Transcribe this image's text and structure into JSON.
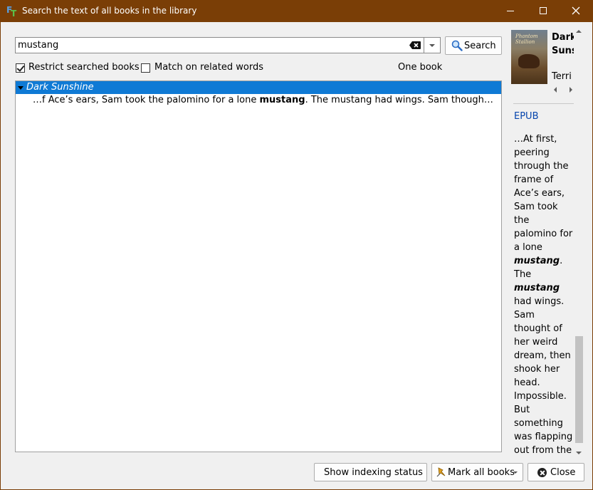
{
  "window": {
    "title": "Search the text of all books in the library"
  },
  "search": {
    "query": "mustang",
    "button_label": "Search"
  },
  "options": {
    "restrict_label": "Restrict searched books",
    "restrict_checked": true,
    "related_label": "Match on related words",
    "related_checked": false,
    "count_text": "One book"
  },
  "results": [
    {
      "book_title": "Dark Sunshine",
      "snippet_before": "…f Ace’s ears, Sam took the palomino for a lone ",
      "snippet_match": "mustang",
      "snippet_after": ". The mustang had wings. Sam thought of her w…"
    }
  ],
  "details": {
    "title": "Dark Sunshine",
    "author": "Terri",
    "cover_title": "Phantom Stallion",
    "format": "EPUB",
    "text_1": "…At first, peering through the frame of Ace’s ears, Sam took the palomino for a lone ",
    "match_1": "mustang",
    "text_2": ". The ",
    "match_2": "mustang",
    "text_3": " had wings. Sam thought of her weird dream, then shook her head. Impossible. But something was flapping out from the"
  },
  "footer": {
    "indexing_label": "Show indexing status",
    "mark_label": "Mark all books",
    "close_label": "Close"
  }
}
